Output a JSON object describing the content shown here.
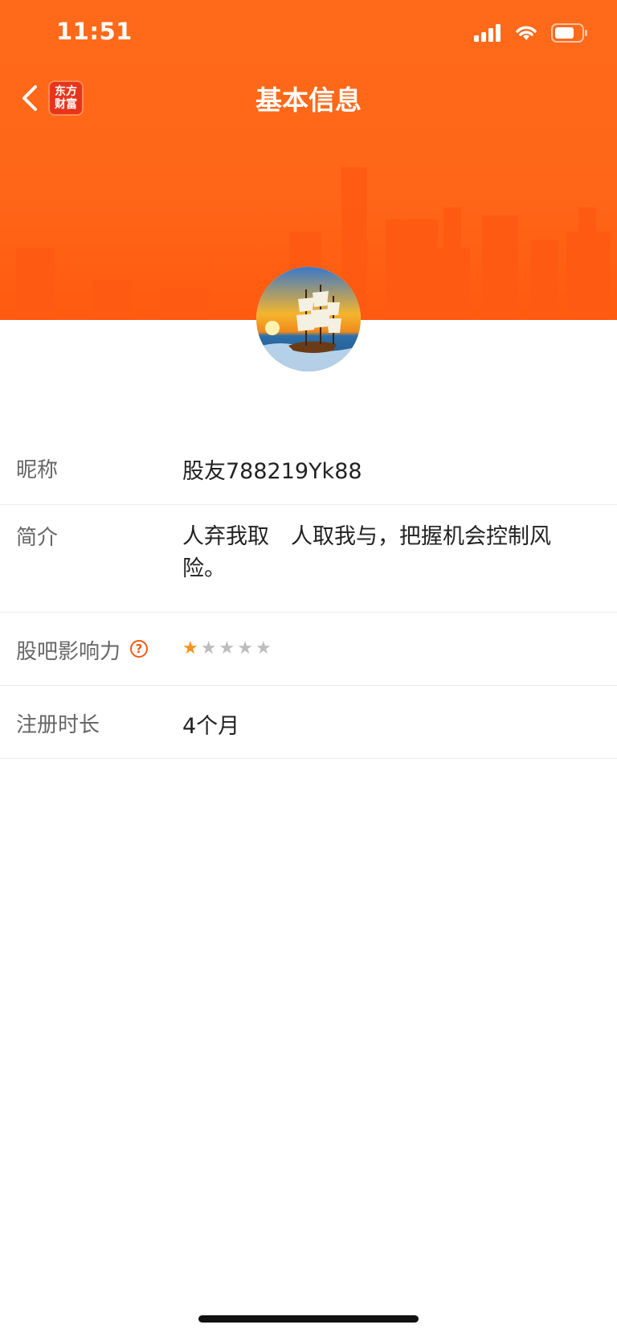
{
  "status_bar": {
    "time": "11:51"
  },
  "nav": {
    "title": "基本信息",
    "logo_line1": "东方",
    "logo_line2": "财富"
  },
  "profile": {
    "nickname_label": "昵称",
    "nickname": "股友788219Yk88",
    "bio_label": "简介",
    "bio": "人弃我取　人取我与，把握机会控制风险。",
    "influence_label": "股吧影响力",
    "influence_rating": 1,
    "influence_max": 5,
    "registration_label": "注册时长",
    "registration": "4个月"
  },
  "colors": {
    "header_orange": "#ff6618",
    "accent": "#f05a14",
    "star_active": "#f7931e",
    "star_inactive": "#bdbdbd"
  }
}
